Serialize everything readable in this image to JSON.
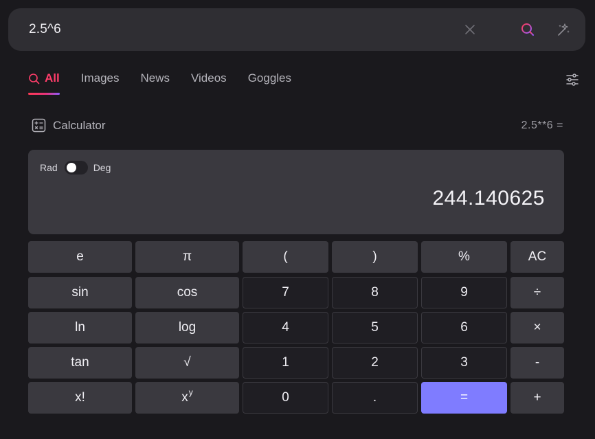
{
  "search": {
    "query": "2.5^6"
  },
  "tabs": [
    {
      "label": "All",
      "active": true
    },
    {
      "label": "Images"
    },
    {
      "label": "News"
    },
    {
      "label": "Videos"
    },
    {
      "label": "Goggles"
    }
  ],
  "calculator": {
    "title": "Calculator",
    "expression": "2.5**6 =",
    "mode": {
      "left": "Rad",
      "right": "Deg",
      "selected": "Rad"
    },
    "result": "244.140625",
    "keys": {
      "e": "e",
      "pi": "π",
      "lparen": "(",
      "rparen": ")",
      "percent": "%",
      "ac": "AC",
      "sin": "sin",
      "cos": "cos",
      "seven": "7",
      "eight": "8",
      "nine": "9",
      "divide": "÷",
      "ln": "ln",
      "log": "log",
      "four": "4",
      "five": "5",
      "six": "6",
      "multiply": "×",
      "tan": "tan",
      "sqrt": "√",
      "one": "1",
      "two": "2",
      "three": "3",
      "minus": "-",
      "factorial": "x!",
      "power_base": "x",
      "power_exp": "y",
      "zero": "0",
      "dot": ".",
      "equals": "=",
      "plus": "+"
    }
  },
  "colors": {
    "accent": "#ff3d6a",
    "equals_key": "#7f7cff",
    "background": "#1a191d"
  },
  "icons": [
    "clear-icon",
    "search-icon",
    "ai-sparkle-icon",
    "tab-search-icon",
    "filter-sliders-icon",
    "calculator-icon"
  ]
}
